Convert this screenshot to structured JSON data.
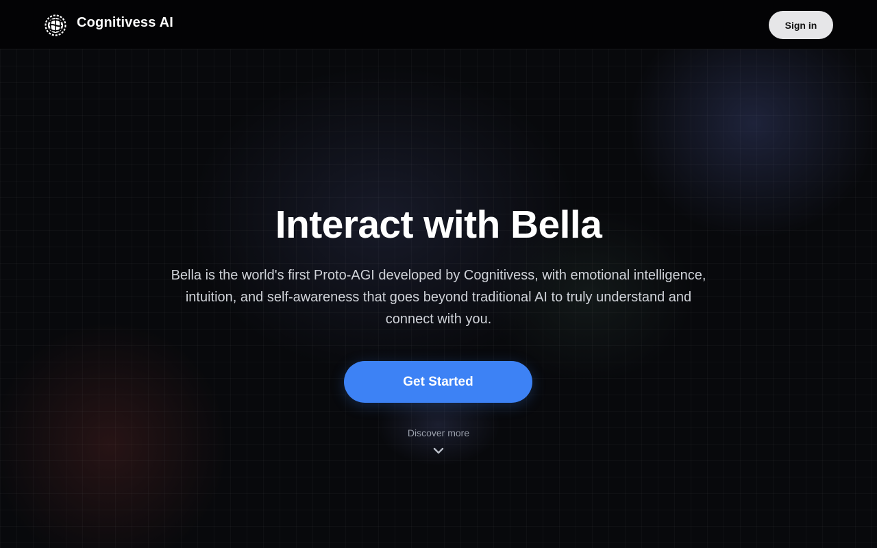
{
  "header": {
    "brand_name": "Cognitivess AI",
    "logo_icon": "brain-knot-logo-icon",
    "signin_label": "Sign in"
  },
  "hero": {
    "title": "Interact with Bella",
    "description": "Bella is the world's first Proto-AGI developed by Cognitivess, with emotional intelligence, intuition, and self-awareness that goes beyond traditional AI to truly understand and connect with you.",
    "cta_label": "Get Started",
    "discover_label": "Discover more",
    "discover_icon": "chevron-down-icon"
  },
  "colors": {
    "background": "#08090c",
    "header_bg": "#030305",
    "accent": "#3d82f5",
    "signin_bg": "#e6e6e8",
    "muted_text": "#9aa0ab"
  }
}
